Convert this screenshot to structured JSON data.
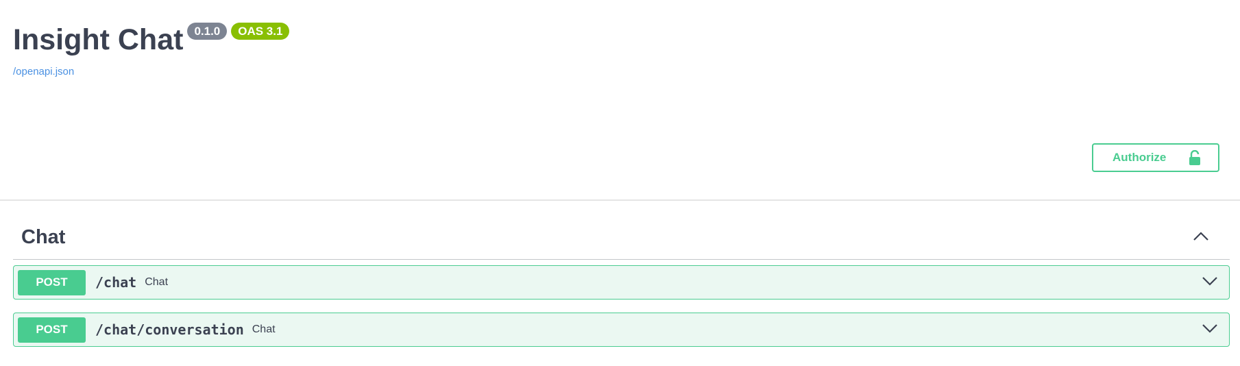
{
  "info": {
    "title": "Insight Chat",
    "version_badge": "0.1.0",
    "oas_badge": "OAS 3.1",
    "spec_link": "/openapi.json"
  },
  "auth": {
    "label": "Authorize",
    "icon": "unlocked-padlock-icon"
  },
  "section": {
    "title": "Chat",
    "toggle_icon": "chevron-up-icon",
    "operations": [
      {
        "method": "POST",
        "path": "/chat",
        "summary": "Chat"
      },
      {
        "method": "POST",
        "path": "/chat/conversation",
        "summary": "Chat"
      }
    ]
  },
  "colors": {
    "post": "#49cc90",
    "post_bg": "#ebf8f2",
    "version_badge": "#7d8492",
    "oas_badge": "#89bf04",
    "link": "#4990e2",
    "text": "#3b4151"
  }
}
